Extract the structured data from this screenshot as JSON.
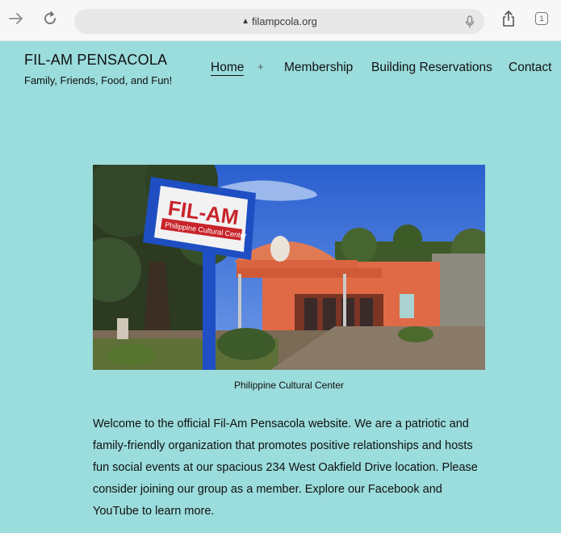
{
  "browser": {
    "url": "filampcola.org",
    "tab_count": "1"
  },
  "site": {
    "title": "FIL-AM PENSACOLA",
    "tagline": "Family, Friends, Food, and Fun!"
  },
  "nav": {
    "home": "Home",
    "submenu_indicator": "+",
    "membership": "Membership",
    "reservations": "Building Reservations",
    "contact": "Contact"
  },
  "hero": {
    "sign_line1": "FIL-AM",
    "sign_line2": "Philippine Cultural Center",
    "caption": "Philippine Cultural Center"
  },
  "content": {
    "intro": "Welcome to the official Fil-Am Pensacola website. We are a patriotic and family-friendly organization that promotes positive relationships and hosts fun social events at our spacious 234 West Oakfield Drive location. Please consider joining our group as a member. Explore our Facebook and YouTube to learn more."
  }
}
